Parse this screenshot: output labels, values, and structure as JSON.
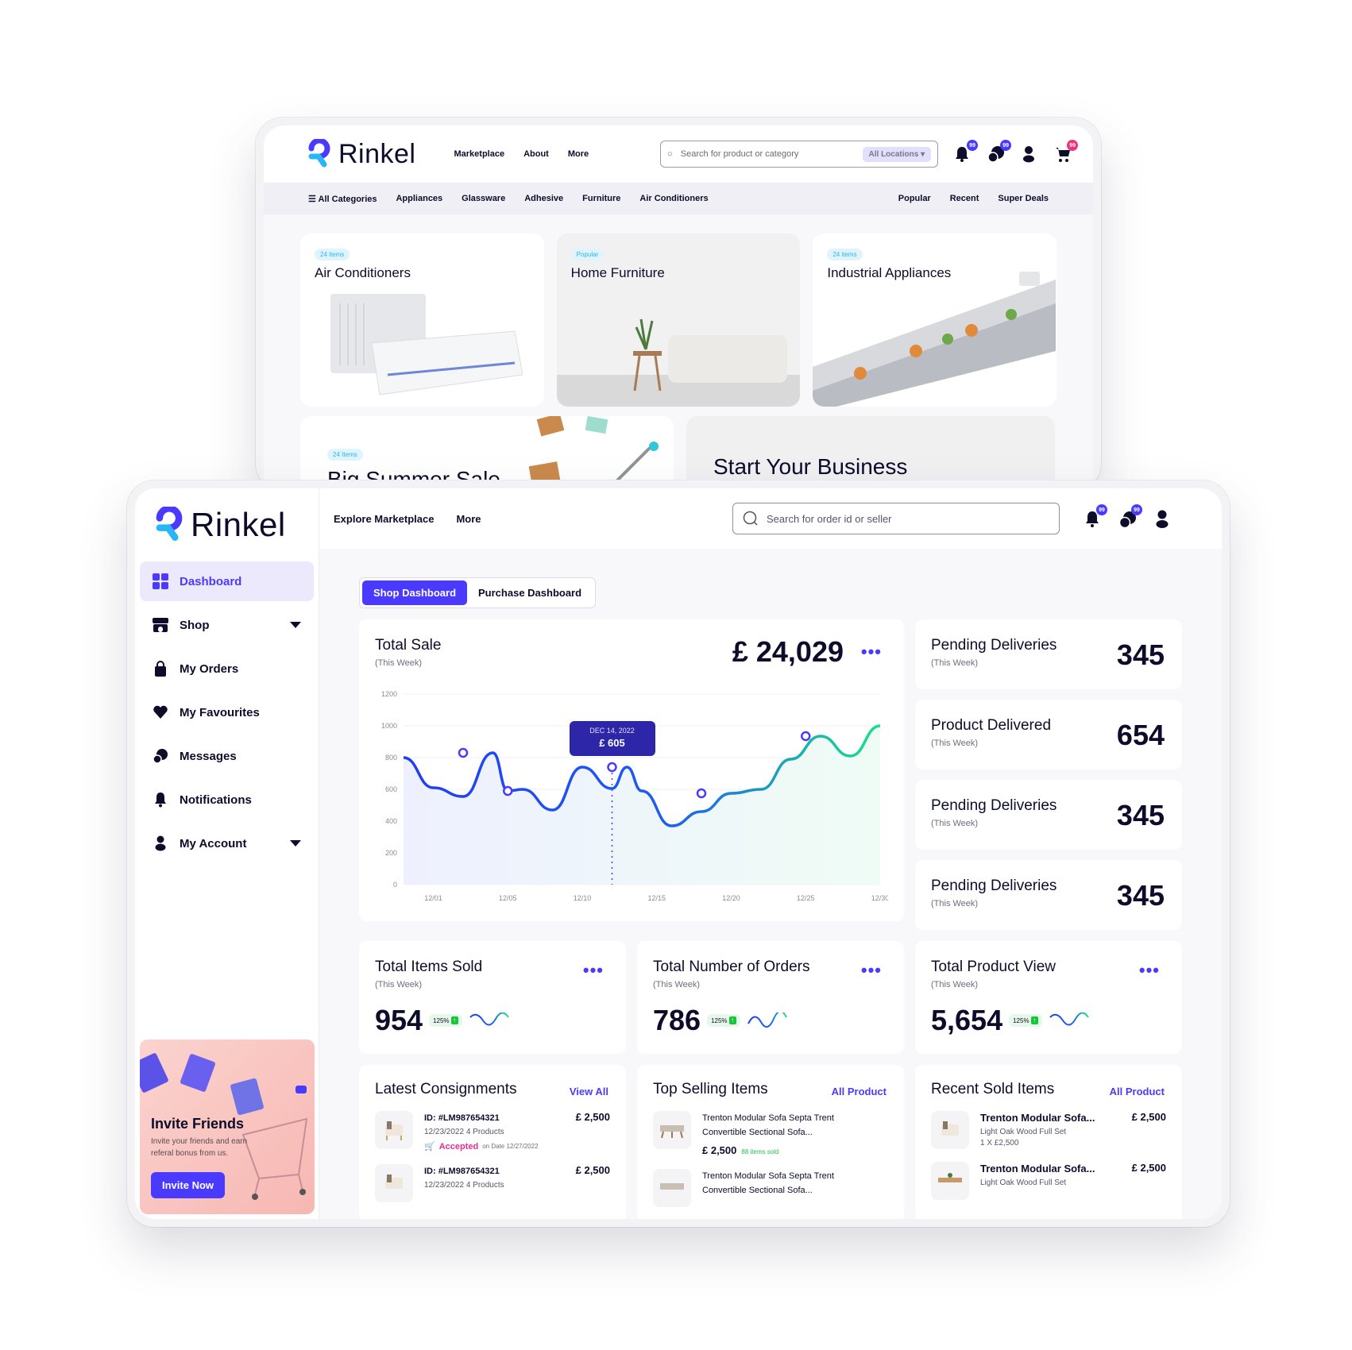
{
  "back": {
    "brand": "Rinkel",
    "nav": [
      "Marketplace",
      "About",
      "More"
    ],
    "search": {
      "placeholder": "Search for product or category",
      "location": "All Locations"
    },
    "badges": {
      "notifications": "99",
      "messages": "99",
      "cart": "99"
    },
    "categories": [
      "All Categories",
      "Appliances",
      "Glassware",
      "Adhesive",
      "Furniture",
      "Air Conditioners"
    ],
    "right_links": [
      "Popular",
      "Recent",
      "Super Deals"
    ],
    "cards": [
      {
        "pill": "24 items",
        "title": "Air Conditioners"
      },
      {
        "pill": "Popular",
        "title": "Home Furniture"
      },
      {
        "pill": "24 items",
        "title": "Industrial Appliances"
      }
    ],
    "promo": {
      "pill": "24 Items",
      "title": "Big Summer Sale"
    },
    "business": {
      "title": "Start Your Business"
    }
  },
  "front": {
    "brand": "Rinkel",
    "nav": [
      "Explore Marketplace",
      "More"
    ],
    "search_placeholder": "Search for order id or seller",
    "badges": {
      "notifications": "99",
      "messages": "99"
    },
    "sidebar": [
      {
        "label": "Dashboard",
        "icon": "grid-icon",
        "active": true
      },
      {
        "label": "Shop",
        "icon": "shop-icon"
      },
      {
        "label": "My Orders",
        "icon": "bag-icon"
      },
      {
        "label": "My Favourites",
        "icon": "heart-icon"
      },
      {
        "label": "Messages",
        "icon": "chat-icon"
      },
      {
        "label": "Notifications",
        "icon": "bell-icon"
      },
      {
        "label": "My Account",
        "icon": "user-icon"
      }
    ],
    "invite": {
      "title": "Invite Friends",
      "text": "Invite your friends and earn referal bonus from us.",
      "button": "Invite Now"
    },
    "tabs": [
      "Shop Dashboard",
      "Purchase Dashboard"
    ],
    "total_sale": {
      "title": "Total Sale",
      "period": "(This Week)",
      "value": "£ 24,029"
    },
    "tooltip": {
      "date": "DEC 14, 2022",
      "value": "£ 605"
    },
    "stats": [
      {
        "title": "Pending Deliveries",
        "period": "(This Week)",
        "value": "345"
      },
      {
        "title": "Product Delivered",
        "period": "(This Week)",
        "value": "654"
      },
      {
        "title": "Pending Deliveries",
        "period": "(This Week)",
        "value": "345"
      },
      {
        "title": "Pending Deliveries",
        "period": "(This Week)",
        "value": "345"
      }
    ],
    "kpis": [
      {
        "title": "Total Items Sold",
        "period": "(This Week)",
        "value": "954",
        "change": "125%"
      },
      {
        "title": "Total Number of Orders",
        "period": "(This Week)",
        "value": "786",
        "change": "125%"
      },
      {
        "title": "Total Product View",
        "period": "(This Week)",
        "value": "5,654",
        "change": "125%"
      }
    ],
    "consignments": {
      "title": "Latest Consignments",
      "link": "View All",
      "items": [
        {
          "id": "ID: #LM987654321",
          "meta": "12/23/2022   4 Products",
          "price": "£ 2,500",
          "status": "Accepted",
          "status_date": "on Date 12/27/2022"
        },
        {
          "id": "ID: #LM987654321",
          "meta": "12/23/2022   4 Products",
          "price": "£ 2,500"
        }
      ]
    },
    "top_selling": {
      "title": "Top Selling Items",
      "link": "All Product",
      "items": [
        {
          "name": "Trenton Modular Sofa Septa Trent Convertible Sectional Sofa...",
          "price": "£ 2,500",
          "sold": "88 items sold"
        },
        {
          "name": "Trenton Modular Sofa Septa Trent Convertible Sectional Sofa..."
        }
      ]
    },
    "recent_sold": {
      "title": "Recent Sold Items",
      "link": "All Product",
      "items": [
        {
          "name": "Trenton Modular Sofa...",
          "meta": "Light Oak Wood   Full Set",
          "qty": "1 X £2,500",
          "price": "£ 2,500"
        },
        {
          "name": "Trenton Modular Sofa...",
          "meta": "Light Oak Wood   Full Set",
          "price": "£ 2,500"
        }
      ]
    }
  },
  "chart_data": {
    "type": "line",
    "title": "Total Sale (This Week)",
    "x": [
      0,
      2,
      4,
      6,
      7,
      8,
      10,
      12,
      14,
      15,
      16,
      18,
      20,
      22,
      24,
      26,
      28,
      30,
      32
    ],
    "values": [
      800,
      610,
      555,
      830,
      590,
      600,
      470,
      740,
      605,
      740,
      590,
      370,
      460,
      575,
      600,
      790,
      935,
      810,
      1000
    ],
    "markers": [
      {
        "x": 4,
        "y": 830
      },
      {
        "x": 7,
        "y": 590
      },
      {
        "x": 14,
        "y": 740
      },
      {
        "x": 20,
        "y": 575
      },
      {
        "x": 27,
        "y": 935
      }
    ],
    "xticks": [
      "12/01",
      "12/05",
      "12/10",
      "12/15",
      "12/20",
      "12/25",
      "12/30"
    ],
    "yticks": [
      0,
      200,
      400,
      600,
      800,
      1000,
      1200
    ],
    "ylim": [
      0,
      1200
    ],
    "grid": true,
    "colors": {
      "start": "#1f3df5",
      "end": "#19e08a"
    }
  },
  "colors": {
    "accent": "#4a3aff",
    "dark": "#0d0c2b",
    "pink": "#f0327a",
    "green": "#18c53a"
  }
}
